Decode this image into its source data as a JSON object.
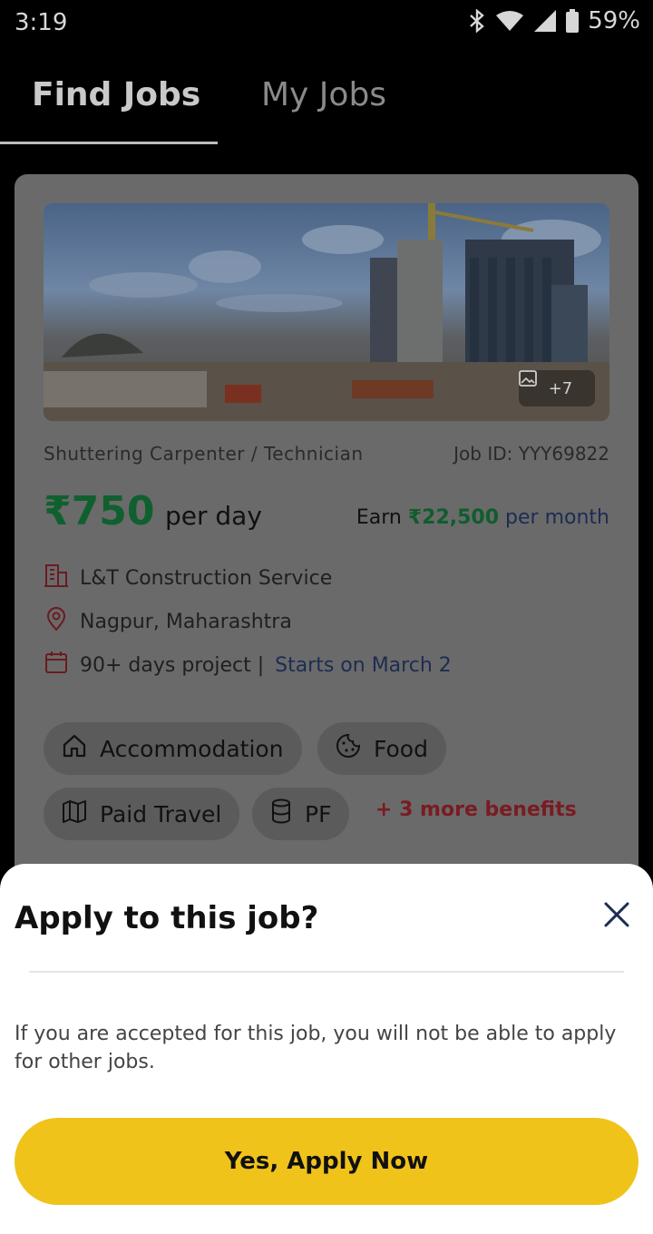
{
  "status_bar": {
    "time": "3:19",
    "battery": "59%"
  },
  "tabs": [
    {
      "label": "Find Jobs",
      "active": true
    },
    {
      "label": "My Jobs",
      "active": false
    }
  ],
  "job": {
    "photo_count": "+7",
    "title": "Shuttering Carpenter / Technician",
    "job_id": "Job ID: YYY69822",
    "wage": "₹750",
    "wage_unit": "per day",
    "earn_label": "Earn",
    "earn_amount": "₹22,500",
    "earn_unit": "per month",
    "company": "L&T Construction Service",
    "location": "Nagpur, Maharashtra",
    "duration": "90+ days project |",
    "start": "Starts on March 2",
    "benefits": [
      "Accommodation",
      "Food",
      "Paid Travel",
      "PF"
    ],
    "more_benefits": "+ 3 more benefits"
  },
  "sheet": {
    "title": "Apply to this job?",
    "message": "If you are accepted for this job, you will not be able to apply for other jobs.",
    "apply_label": "Yes, Apply Now"
  },
  "colors": {
    "accent": "#f0c31b",
    "wage_green": "#10602f",
    "navy": "#1d2c52"
  }
}
